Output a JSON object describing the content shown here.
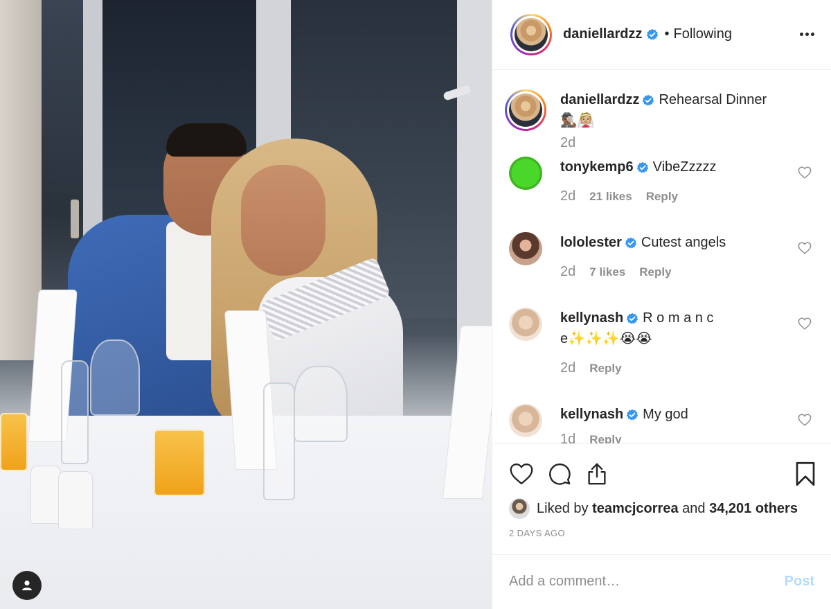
{
  "post": {
    "author": {
      "username": "daniellardzz",
      "verified_icon": "verified-badge-icon",
      "follow_status": "Following",
      "separator": "•"
    },
    "caption": {
      "username": "daniellardzz",
      "text": "Rehearsal Dinner 🕵🏾‍♂️👰🏼",
      "time": "2d"
    },
    "comments": [
      {
        "username": "tonykemp6",
        "text": "VibeZzzzz",
        "time": "2d",
        "likes": "21 likes",
        "reply": "Reply",
        "avatar_color": "#3ecf23"
      },
      {
        "username": "lololester",
        "text": "Cutest angels",
        "time": "2d",
        "likes": "7 likes",
        "reply": "Reply",
        "avatar_color": "#8a6a5a"
      },
      {
        "username": "kellynash",
        "text": "R o m a n c e✨✨✨😭😭",
        "time": "2d",
        "likes": "",
        "reply": "Reply",
        "avatar_color": "#e6c3a6"
      },
      {
        "username": "kellynash",
        "text": "My god",
        "time": "1d",
        "likes": "",
        "reply": "Reply",
        "avatar_color": "#e6c3a6"
      }
    ],
    "liked_by": {
      "prefix": "Liked by",
      "user": "teamcjcorrea",
      "suffix": "and",
      "others": "34,201 others"
    },
    "date": "2 DAYS AGO",
    "add_comment": {
      "placeholder": "Add a comment…",
      "post_label": "Post"
    },
    "icons": {
      "like": "heart-icon",
      "comment": "comment-icon",
      "share": "share-icon",
      "save": "bookmark-icon",
      "more": "more-options-icon",
      "tag": "user-tag-icon"
    },
    "colors": {
      "text": "#262626",
      "muted": "#8e8e8e",
      "verified": "#3897f0",
      "post_disabled": "#b3dbff",
      "border": "#efefef"
    }
  }
}
